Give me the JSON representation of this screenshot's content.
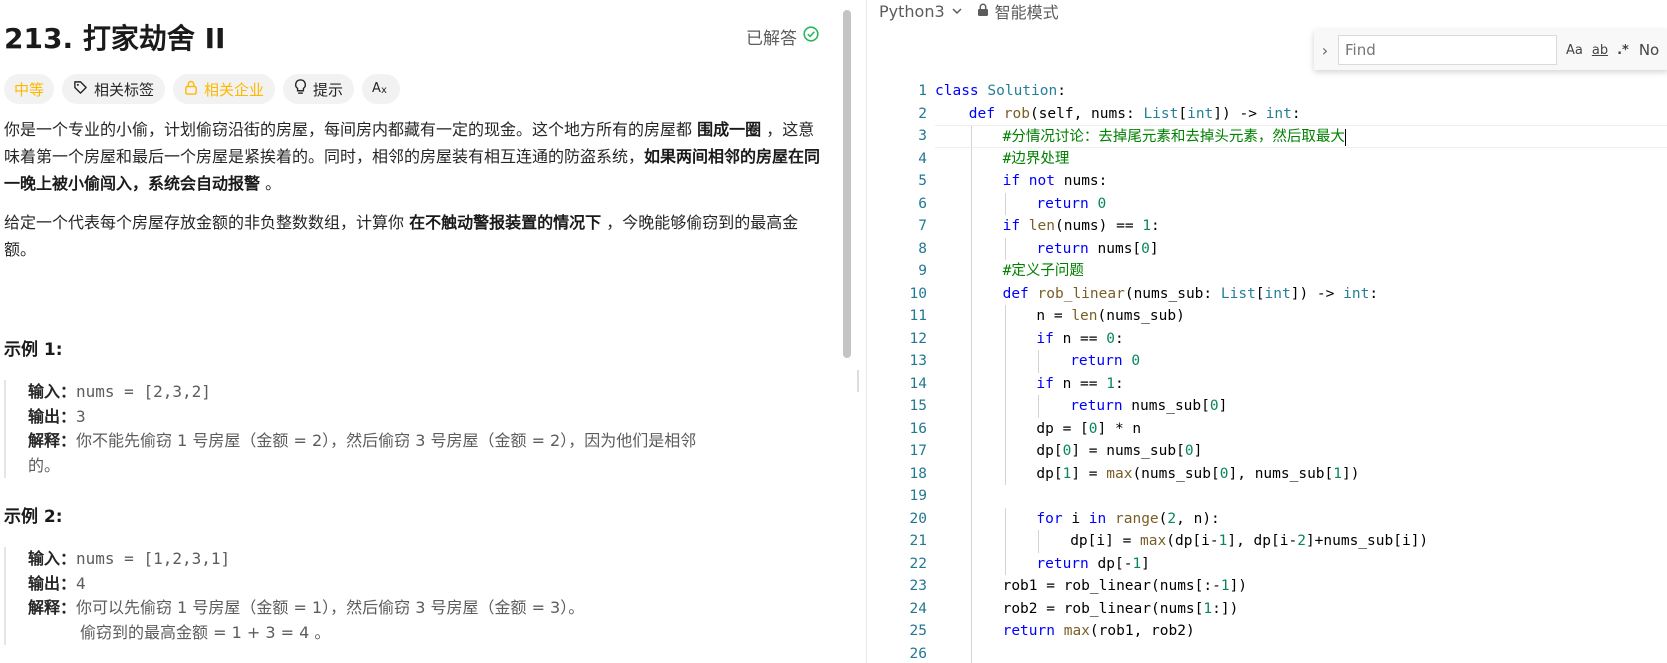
{
  "problem": {
    "title": "213. 打家劫舍 II",
    "solved_label": "已解答",
    "tags": {
      "difficulty": "中等",
      "topics": "相关标签",
      "companies": "相关企业",
      "hint": "提示"
    },
    "desc1": {
      "s1": "你是一个专业的小偷，计划偷窃沿街的房屋，每间房内都藏有一定的现金。这个地方所有的房屋都 ",
      "b1": "围成一圈",
      "s2": " ，这意味着第一个房屋和最后一个房屋是紧挨着的。同时，相邻的房屋装有相互连通的防盗系统，",
      "b2": "如果两间相邻的房屋在同一晚上被小偷闯入，系统会自动报警",
      "s3": " 。"
    },
    "desc2": {
      "s1": "给定一个代表每个房屋存放金额的非负整数数组，计算你 ",
      "b1": "在不触动警报装置的情况下",
      "s2": " ，今晚能够偷窃到的最高金额。"
    },
    "examples": [
      {
        "title": "示例 1:",
        "input_label": "输入：",
        "input": "nums = [2,3,2]",
        "output_label": "输出：",
        "output": "3",
        "explain_label": "解释：",
        "explain": "你不能先偷窃 1 号房屋（金额 = 2），然后偷窃 3 号房屋（金额 = 2），因为他们是相邻",
        "explain_cont": "的。"
      },
      {
        "title": "示例 2:",
        "input_label": "输入：",
        "input": "nums = [1,2,3,1]",
        "output_label": "输出：",
        "output": "4",
        "explain_label": "解释：",
        "explain": "你可以先偷窃 1 号房屋（金额 = 1），然后偷窃 3 号房屋（金额 = 3）。",
        "explain_cont": "偷窃到的最高金额 = 1 + 3 = 4 。"
      }
    ]
  },
  "editor": {
    "language": "Python3",
    "mode": "智能模式",
    "find": {
      "placeholder": "Find",
      "match_case": "Aa",
      "whole_word": "ab",
      "regex": ".*",
      "result": "No"
    },
    "line_numbers": [
      "1",
      "2",
      "3",
      "4",
      "5",
      "6",
      "7",
      "8",
      "9",
      "10",
      "11",
      "12",
      "13",
      "14",
      "15",
      "16",
      "17",
      "18",
      "19",
      "20",
      "21",
      "22",
      "23",
      "24",
      "25",
      "26"
    ]
  },
  "colors": {
    "difficulty_medium": "#ffb800",
    "solved_check": "#2db55d",
    "keyword": "#0000ff",
    "comment": "#008000",
    "number": "#098658",
    "type": "#267f99",
    "function": "#795e26"
  }
}
